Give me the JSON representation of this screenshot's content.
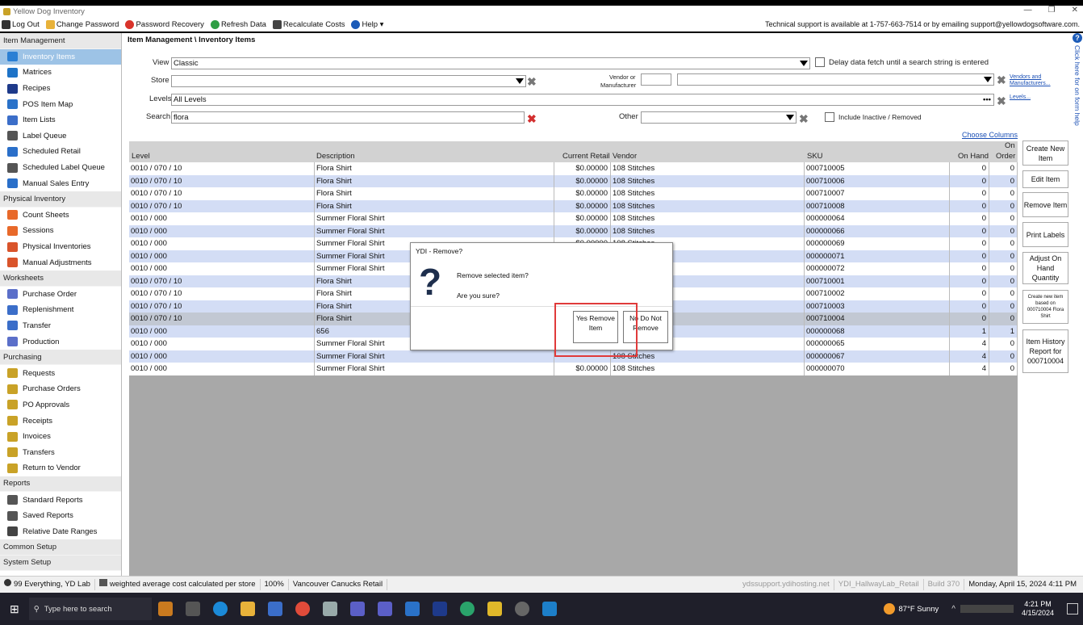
{
  "app": {
    "title": "Yellow Dog Inventory"
  },
  "toolbar": {
    "items": [
      {
        "label": "Log Out",
        "icon": "logout-icon"
      },
      {
        "label": "Change Password",
        "icon": "key-icon"
      },
      {
        "label": "Password Recovery",
        "icon": "lifebuoy-icon"
      },
      {
        "label": "Refresh Data",
        "icon": "refresh-icon"
      },
      {
        "label": "Recalculate Costs",
        "icon": "bank-icon"
      },
      {
        "label": "Help ▾",
        "icon": "help-icon"
      }
    ],
    "support": "Technical support is available at 1-757-663-7514 or by emailing support@yellowdogsoftware.com."
  },
  "sidebar": {
    "sections": [
      {
        "title": "Item Management",
        "items": [
          "Inventory Items",
          "Matrices",
          "Recipes",
          "POS Item Map",
          "Item Lists",
          "Label Queue",
          "Scheduled Retail",
          "Scheduled Label Queue",
          "Manual Sales Entry"
        ]
      },
      {
        "title": "Physical Inventory",
        "items": [
          "Count Sheets",
          "Sessions",
          "Physical Inventories",
          "Manual Adjustments"
        ]
      },
      {
        "title": "Worksheets",
        "items": [
          "Purchase Order",
          "Replenishment",
          "Transfer",
          "Production"
        ]
      },
      {
        "title": "Purchasing",
        "items": [
          "Requests",
          "Purchase Orders",
          "PO Approvals",
          "Receipts",
          "Invoices",
          "Transfers",
          "Return to Vendor"
        ]
      },
      {
        "title": "Reports",
        "items": [
          "Standard Reports",
          "Saved Reports",
          "Relative Date Ranges"
        ]
      },
      {
        "title": "Common Setup",
        "items": []
      },
      {
        "title": "System Setup",
        "items": []
      }
    ]
  },
  "main": {
    "breadcrumb": "Item Management \\ Inventory Items",
    "filters": {
      "view_label": "View",
      "view_value": "Classic",
      "delay_label": "Delay data fetch until a search string is entered",
      "store_label": "Store",
      "store_value": "",
      "vendor_label_1": "Vendor or",
      "vendor_label_2": "Manufacturer",
      "vendors_link_1": "Vendors and",
      "vendors_link_2": "Manufacturers...",
      "levels_label": "Levels",
      "levels_value": "All Levels",
      "levels_link": "Levels...",
      "search_label": "Search",
      "search_value": "flora",
      "other_label": "Other",
      "include_inactive": "Include Inactive / Removed"
    },
    "choose_columns": "Choose Columns",
    "columns": {
      "level": "Level",
      "description": "Description",
      "retail": "Current Retail",
      "vendor": "Vendor",
      "sku": "SKU",
      "on_hand": "On Hand",
      "on_order_1": "On",
      "on_order_2": "Order"
    },
    "rows": [
      [
        "0010 / 070 / 10",
        "Flora Shirt",
        "$0.00000",
        "108 Stitches",
        "000710005",
        "0",
        "0"
      ],
      [
        "0010 / 070 / 10",
        "Flora Shirt",
        "$0.00000",
        "108 Stitches",
        "000710006",
        "0",
        "0"
      ],
      [
        "0010 / 070 / 10",
        "Flora Shirt",
        "$0.00000",
        "108 Stitches",
        "000710007",
        "0",
        "0"
      ],
      [
        "0010 / 070 / 10",
        "Flora Shirt",
        "$0.00000",
        "108 Stitches",
        "000710008",
        "0",
        "0"
      ],
      [
        "0010 / 000",
        "Summer Floral Shirt",
        "$0.00000",
        "108 Stitches",
        "000000064",
        "0",
        "0"
      ],
      [
        "0010 / 000",
        "Summer Floral Shirt",
        "$0.00000",
        "108 Stitches",
        "000000066",
        "0",
        "0"
      ],
      [
        "0010 / 000",
        "Summer Floral Shirt",
        "$0.00000",
        "108 Stitches",
        "000000069",
        "0",
        "0"
      ],
      [
        "0010 / 000",
        "Summer Floral Shirt",
        "",
        "",
        "000000071",
        "0",
        "0"
      ],
      [
        "0010 / 000",
        "Summer Floral Shirt",
        "",
        "",
        "000000072",
        "0",
        "0"
      ],
      [
        "0010 / 070 / 10",
        "Flora Shirt",
        "",
        "",
        "000710001",
        "0",
        "0"
      ],
      [
        "0010 / 070 / 10",
        "Flora Shirt",
        "",
        "",
        "000710002",
        "0",
        "0"
      ],
      [
        "0010 / 070 / 10",
        "Flora Shirt",
        "",
        "",
        "000710003",
        "0",
        "0"
      ],
      [
        "0010 / 070 / 10",
        "Flora Shirt",
        "",
        "",
        "000710004",
        "0",
        "0"
      ],
      [
        "0010 / 000",
        "656",
        "",
        "",
        "000000068",
        "1",
        "1"
      ],
      [
        "0010 / 000",
        "Summer Floral Shirt",
        "",
        "",
        "000000065",
        "4",
        "0"
      ],
      [
        "0010 / 000",
        "Summer Floral Shirt",
        "",
        "108 Stitches",
        "000000067",
        "4",
        "0"
      ],
      [
        "0010 / 000",
        "Summer Floral Shirt",
        "$0.00000",
        "108 Stitches",
        "000000070",
        "4",
        "0"
      ]
    ],
    "actions": [
      "Create New Item",
      "Edit Item",
      "Remove Item",
      "Print Labels",
      "Adjust On Hand Quantity",
      "Create new item based on 000710004 Flora Shirt",
      "Item History Report for 000710004"
    ],
    "help_strip": "Click here for on form help"
  },
  "dialog": {
    "title": "YDI - Remove?",
    "question": "Remove  selected  item?",
    "confirm": "Are you sure?",
    "yes_label": "Yes Remove Item",
    "no_label": "No Do Not Remove"
  },
  "statusbar": {
    "user": "99 Everything, YD Lab",
    "cost": "weighted average cost calculated per store",
    "zoom": "100%",
    "store": "Vancouver Canucks Retail",
    "host": "ydssupport.ydihosting.net",
    "db": "YDI_HallwayLab_Retail",
    "build": "Build 370",
    "datetime": "Monday, April 15, 2024 4:11 PM"
  },
  "taskbar": {
    "search_placeholder": "Type here to search",
    "weather": "87°F  Sunny",
    "time": "4:21 PM",
    "date": "4/15/2024"
  }
}
